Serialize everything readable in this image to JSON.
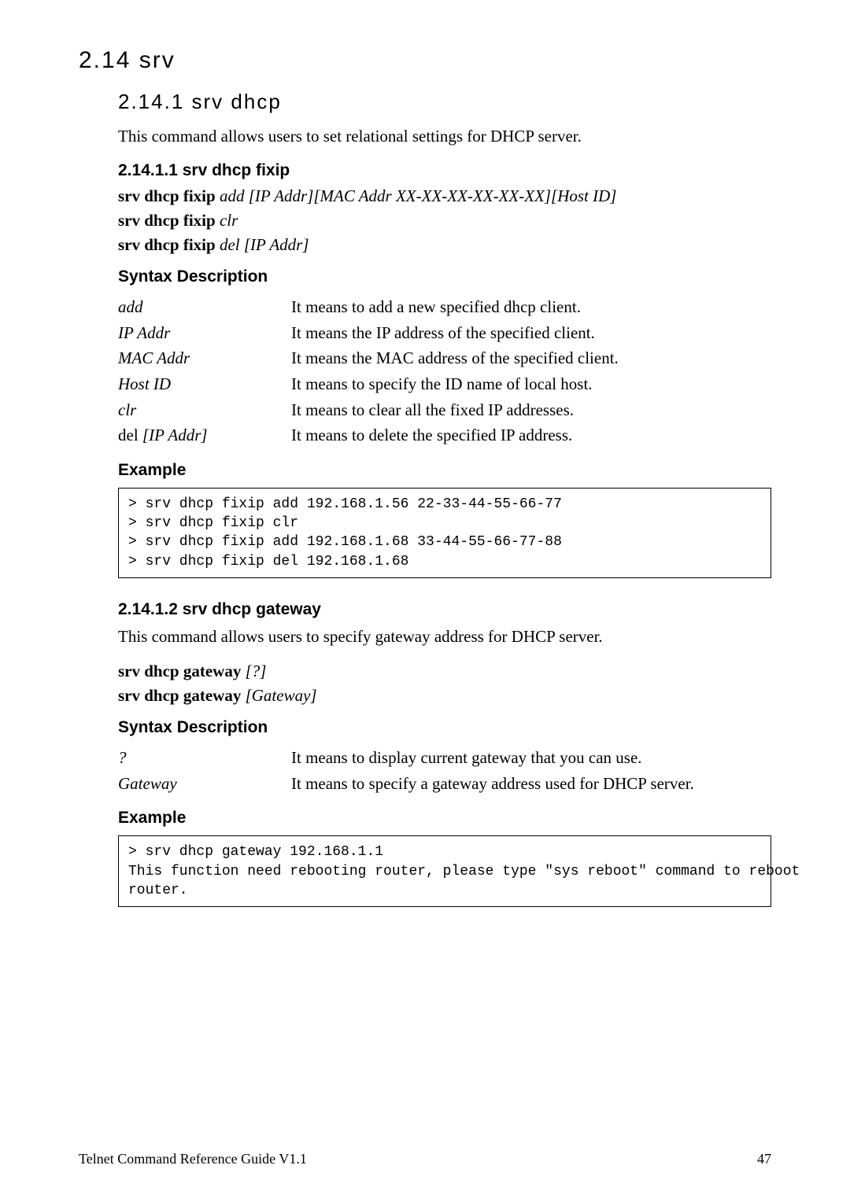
{
  "section": {
    "h1": "2.14 srv",
    "h2": "2.14.1 srv dhcp",
    "intro": "This command allows users to set relational settings for DHCP server.",
    "sub1": {
      "title": "2.14.1.1 srv dhcp fixip",
      "cmds": [
        {
          "bold": "srv dhcp fixip ",
          "ital": "add [IP Addr][MAC Addr XX-XX-XX-XX-XX-XX][Host ID]"
        },
        {
          "bold": "srv dhcp fixip ",
          "ital": "clr"
        },
        {
          "bold": "srv dhcp fixip ",
          "ital": "del [IP Addr]"
        }
      ],
      "syntax_title": "Syntax Description",
      "defs": [
        {
          "term": "add",
          "desc": "It means to add a new specified dhcp client."
        },
        {
          "term": "IP Addr",
          "desc": "It means the IP address of the specified client."
        },
        {
          "term": "MAC Addr",
          "desc": "It means the MAC address of the specified client."
        },
        {
          "term": "Host ID",
          "desc": "It means to specify the ID name of local host."
        },
        {
          "term": "clr",
          "desc": "It means to clear all the fixed IP addresses."
        },
        {
          "term": "del [IP Addr]",
          "desc": "It means to delete the specified IP address."
        }
      ],
      "example_title": "Example",
      "example": "> srv dhcp fixip add 192.168.1.56 22-33-44-55-66-77\n> srv dhcp fixip clr\n> srv dhcp fixip add 192.168.1.68 33-44-55-66-77-88\n> srv dhcp fixip del 192.168.1.68"
    },
    "sub2": {
      "title": "2.14.1.2 srv dhcp gateway",
      "intro": "This command allows users to specify gateway address for DHCP server.",
      "cmds": [
        {
          "bold": "srv dhcp gateway ",
          "ital": "[?]"
        },
        {
          "bold": "srv dhcp gateway ",
          "ital": "[Gateway]"
        }
      ],
      "syntax_title": "Syntax Description",
      "defs": [
        {
          "term": "?",
          "desc": "It means to display current gateway that you can use."
        },
        {
          "term": "Gateway",
          "desc": "It means to specify a gateway address used for DHCP server."
        }
      ],
      "example_title": "Example",
      "example": "> srv dhcp gateway 192.168.1.1\nThis function need rebooting router, please type \"sys reboot\" command to reboot\nrouter."
    }
  },
  "footer": {
    "left": "Telnet Command Reference Guide V1.1",
    "right": "47"
  }
}
